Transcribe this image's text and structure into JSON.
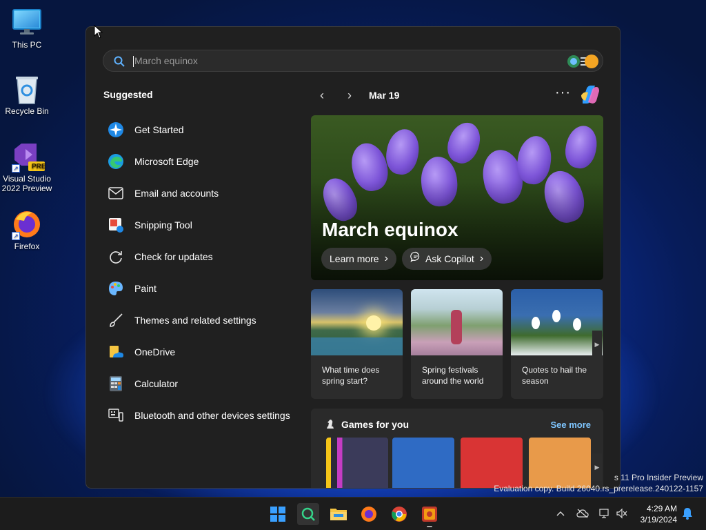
{
  "desktop": {
    "icons": [
      {
        "label": "This PC",
        "icon": "monitor-icon"
      },
      {
        "label": "Recycle Bin",
        "icon": "recycle-bin-icon"
      },
      {
        "label": "Visual Studio 2022 Preview",
        "badge": "PRE",
        "icon": "visual-studio-icon"
      },
      {
        "label": "Firefox",
        "icon": "firefox-icon"
      }
    ]
  },
  "search": {
    "placeholder": "March equinox"
  },
  "suggested": {
    "title": "Suggested",
    "items": [
      {
        "label": "Get Started",
        "icon": "get-started-icon"
      },
      {
        "label": "Microsoft Edge",
        "icon": "edge-icon"
      },
      {
        "label": "Email and accounts",
        "icon": "mail-icon"
      },
      {
        "label": "Snipping Tool",
        "icon": "snipping-tool-icon"
      },
      {
        "label": "Check for updates",
        "icon": "refresh-icon"
      },
      {
        "label": "Paint",
        "icon": "paint-icon"
      },
      {
        "label": "Themes and related settings",
        "icon": "brush-icon"
      },
      {
        "label": "OneDrive",
        "icon": "onedrive-icon"
      },
      {
        "label": "Calculator",
        "icon": "calculator-icon"
      },
      {
        "label": "Bluetooth and other devices settings",
        "icon": "devices-icon"
      }
    ]
  },
  "highlights": {
    "date": "Mar 19",
    "more": "···",
    "hero": {
      "title": "March equinox",
      "learn_more": "Learn more",
      "ask_copilot": "Ask Copilot"
    },
    "cards": [
      {
        "text": "What time does spring start?"
      },
      {
        "text": "Spring festivals around the world"
      },
      {
        "text": "Quotes to hail the season"
      }
    ],
    "games": {
      "title": "Games for you",
      "see_more": "See more"
    }
  },
  "watermark": {
    "line1": "s 11 Pro Insider Preview",
    "line2": "Evaluation copy. Build 26040.rs_prerelease.240122-1157"
  },
  "taskbar": {
    "time": "4:29 AM",
    "date": "3/19/2024"
  },
  "colors": {
    "panel_bg": "#202020",
    "accent_link": "#7fc6ff",
    "taskbar_bg": "#1c1c1c"
  }
}
